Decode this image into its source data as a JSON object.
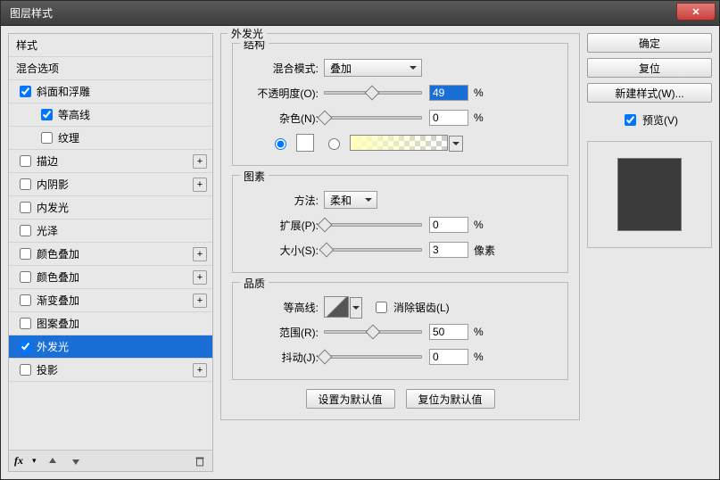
{
  "window": {
    "title": "图层样式"
  },
  "sidebar": {
    "styles_label": "样式",
    "blending_label": "混合选项",
    "items": [
      {
        "label": "斜面和浮雕",
        "checked": true,
        "addable": false
      },
      {
        "label": "等高线",
        "checked": true,
        "sub": true
      },
      {
        "label": "纹理",
        "checked": false,
        "sub": true
      },
      {
        "label": "描边",
        "checked": false,
        "addable": true
      },
      {
        "label": "内阴影",
        "checked": false,
        "addable": true
      },
      {
        "label": "内发光",
        "checked": false,
        "addable": false
      },
      {
        "label": "光泽",
        "checked": false,
        "addable": false
      },
      {
        "label": "颜色叠加",
        "checked": false,
        "addable": true
      },
      {
        "label": "颜色叠加",
        "checked": false,
        "addable": true
      },
      {
        "label": "渐变叠加",
        "checked": false,
        "addable": true
      },
      {
        "label": "图案叠加",
        "checked": false,
        "addable": false
      },
      {
        "label": "外发光",
        "checked": true,
        "addable": false,
        "selected": true
      },
      {
        "label": "投影",
        "checked": false,
        "addable": true
      }
    ],
    "fx_label": "fx"
  },
  "main": {
    "section_title": "外发光",
    "structure": {
      "legend": "结构",
      "blend_mode_label": "混合模式:",
      "blend_mode_value": "叠加",
      "opacity_label": "不透明度(O):",
      "opacity_value": "49",
      "opacity_unit": "%",
      "noise_label": "杂色(N):",
      "noise_value": "0",
      "noise_unit": "%"
    },
    "elements": {
      "legend": "图素",
      "technique_label": "方法:",
      "technique_value": "柔和",
      "spread_label": "扩展(P):",
      "spread_value": "0",
      "spread_unit": "%",
      "size_label": "大小(S):",
      "size_value": "3",
      "size_unit": "像素"
    },
    "quality": {
      "legend": "品质",
      "contour_label": "等高线:",
      "antialias_label": "消除锯齿(L)",
      "range_label": "范围(R):",
      "range_value": "50",
      "range_unit": "%",
      "jitter_label": "抖动(J):",
      "jitter_value": "0",
      "jitter_unit": "%"
    },
    "buttons": {
      "make_default": "设置为默认值",
      "reset_default": "复位为默认值"
    }
  },
  "right": {
    "ok": "确定",
    "cancel": "复位",
    "new_style": "新建样式(W)...",
    "preview_label": "预览(V)",
    "preview_checked": true
  }
}
